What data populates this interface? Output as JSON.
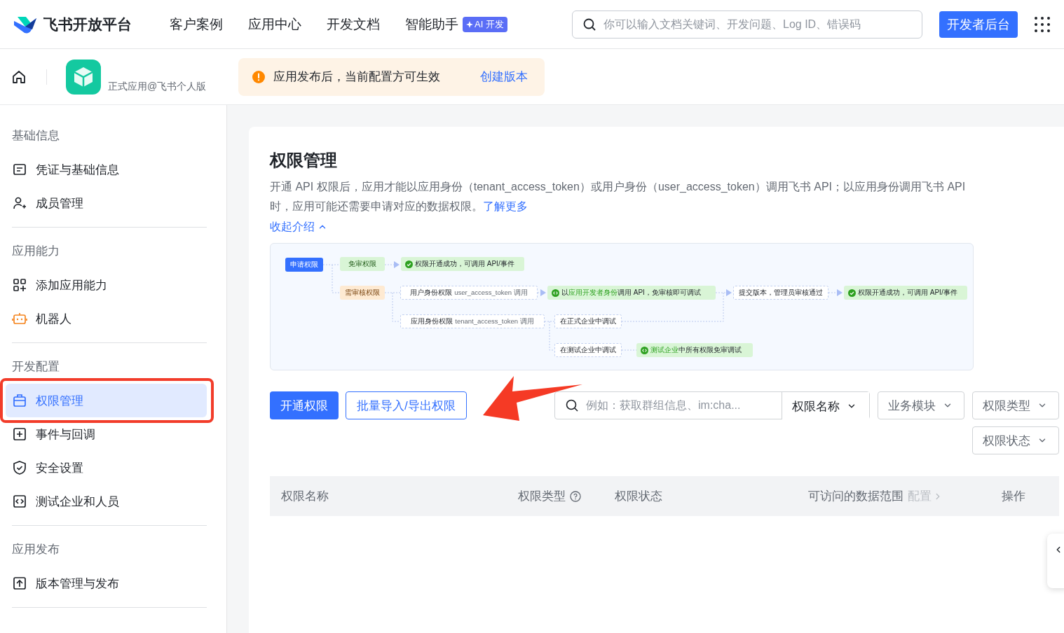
{
  "header": {
    "logo_text": "飞书开放平台",
    "nav": [
      {
        "label": "客户案例"
      },
      {
        "label": "应用中心"
      },
      {
        "label": "开发文档"
      },
      {
        "label": "智能助手",
        "badge": "AI 开发"
      }
    ],
    "search": {
      "placeholder": "你可以输入文档关键词、开发问题、Log ID、错误码"
    },
    "console_button": "开发者后台"
  },
  "app_bar": {
    "app_subtitle": "正式应用@飞书个人版",
    "notice": {
      "text": "应用发布后，当前配置方可生效",
      "link": "创建版本"
    }
  },
  "sidebar": {
    "sections": [
      {
        "title": "基础信息",
        "items": [
          {
            "label": "凭证与基础信息",
            "selected": false
          },
          {
            "label": "成员管理",
            "selected": false
          }
        ]
      },
      {
        "title": "应用能力",
        "items": [
          {
            "label": "添加应用能力",
            "selected": false
          },
          {
            "label": "机器人",
            "selected": false
          }
        ]
      },
      {
        "title": "开发配置",
        "items": [
          {
            "label": "权限管理",
            "selected": true
          },
          {
            "label": "事件与回调",
            "selected": false
          },
          {
            "label": "安全设置",
            "selected": false
          },
          {
            "label": "测试企业和人员",
            "selected": false
          }
        ]
      },
      {
        "title": "应用发布",
        "items": [
          {
            "label": "版本管理与发布",
            "selected": false
          }
        ]
      }
    ]
  },
  "page": {
    "title": "权限管理",
    "intro": "开通 API 权限后，应用才能以应用身份（tenant_access_token）或用户身份（user_access_token）调用飞书 API；以应用身份调用飞书 API 时，应用可能还需要申请对应的数据权限。",
    "intro_link": "了解更多",
    "collapse_link": "收起介绍",
    "flow": {
      "nodes": [
        {
          "kind": "start",
          "text": "申请权限"
        },
        {
          "kind": "exempt",
          "text": "免审权限"
        },
        {
          "kind": "success",
          "text": "权限开通成功，可调用 API/事件"
        },
        {
          "kind": "review",
          "text": "需审核权限"
        },
        {
          "kind": "step",
          "text": "用户身份权限",
          "note": "user_access_token 调用"
        },
        {
          "kind": "debug",
          "segments": [
            {
              "text": "以",
              "accent": false
            },
            {
              "text": "应用开发者身份",
              "accent": true
            },
            {
              "text": "调用 API，免审核即可调试",
              "accent": false
            }
          ]
        },
        {
          "kind": "step",
          "text": "提交版本，管理员审核通过"
        },
        {
          "kind": "success",
          "text": "权限开通成功，可调用 API/事件"
        },
        {
          "kind": "step",
          "text": "应用身份权限",
          "note": "tenant_access_token 调用"
        },
        {
          "kind": "step",
          "text": "在正式企业中调试"
        },
        {
          "kind": "step",
          "text": "在测试企业中调试"
        },
        {
          "kind": "debug",
          "segments": [
            {
              "text": "测试企业",
              "accent": true
            },
            {
              "text": "中所有权限免审调试",
              "accent": false
            }
          ]
        }
      ]
    },
    "actions": [
      {
        "label": "开通权限",
        "primary": true
      },
      {
        "label": "批量导入/导出权限",
        "primary": false
      }
    ],
    "filters": {
      "search_placeholder": "例如：获取群组信息、im:cha...",
      "search_scope": "权限名称",
      "dropdowns": [
        "业务模块",
        "权限类型",
        "权限状态"
      ]
    },
    "table": {
      "columns": [
        {
          "label": "权限名称"
        },
        {
          "label": "权限类型",
          "help": true
        },
        {
          "label": "权限状态"
        },
        {
          "label": "可访问的数据范围",
          "action": "配置"
        },
        {
          "label": "操作"
        }
      ]
    }
  }
}
